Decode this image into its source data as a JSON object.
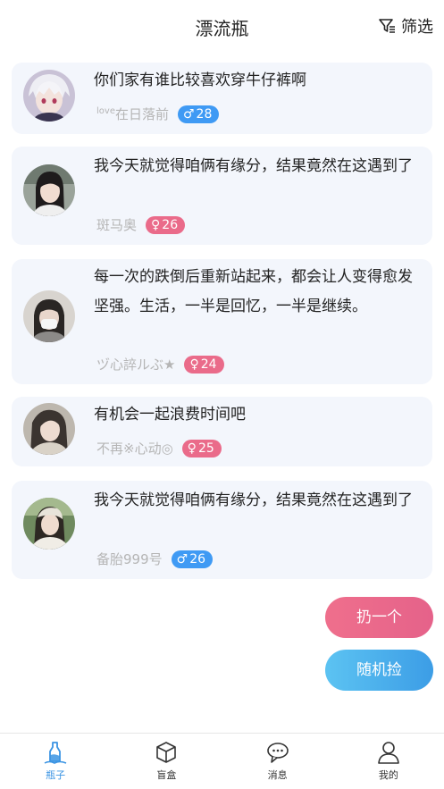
{
  "header": {
    "title": "漂流瓶",
    "filter_label": "筛选"
  },
  "posts": [
    {
      "text": "你们家有谁比较喜欢穿牛仔裤啊",
      "nick_small": "love",
      "nick": "在日落前",
      "gender": "male",
      "symbol": "♂",
      "age": "28"
    },
    {
      "text": "我今天就觉得咱俩有缘分，结果竟然在这遇到了",
      "nick_small": "",
      "nick": "斑马奥",
      "gender": "female",
      "symbol": "♀",
      "age": "26"
    },
    {
      "text": "每一次的跌倒后重新站起来，都会让人变得愈发坚强。生活，一半是回忆，一半是继续。",
      "nick_small": "",
      "nick": "ヅ心誶ルぶ★",
      "gender": "female",
      "symbol": "♀",
      "age": "24"
    },
    {
      "text": "有机会一起浪费时间吧",
      "nick_small": "",
      "nick": "不再※心动◎",
      "gender": "female",
      "symbol": "♀",
      "age": "25"
    },
    {
      "text": "我今天就觉得咱俩有缘分，结果竟然在这遇到了",
      "nick_small": "",
      "nick": "备胎999号",
      "gender": "male",
      "symbol": "♂",
      "age": "26"
    }
  ],
  "actions": {
    "throw_label": "扔一个",
    "pick_label": "随机捡"
  },
  "tabs": [
    {
      "label": "瓶子",
      "icon": "bottle-icon",
      "active": true
    },
    {
      "label": "盲盒",
      "icon": "box-icon",
      "active": false
    },
    {
      "label": "消息",
      "icon": "message-icon",
      "active": false
    },
    {
      "label": "我的",
      "icon": "profile-icon",
      "active": false
    }
  ],
  "colors": {
    "male_badge": "#3f9af4",
    "female_badge": "#ea6b8a",
    "card_bg": "#f3f6fc",
    "active_tab": "#3b94e3"
  }
}
